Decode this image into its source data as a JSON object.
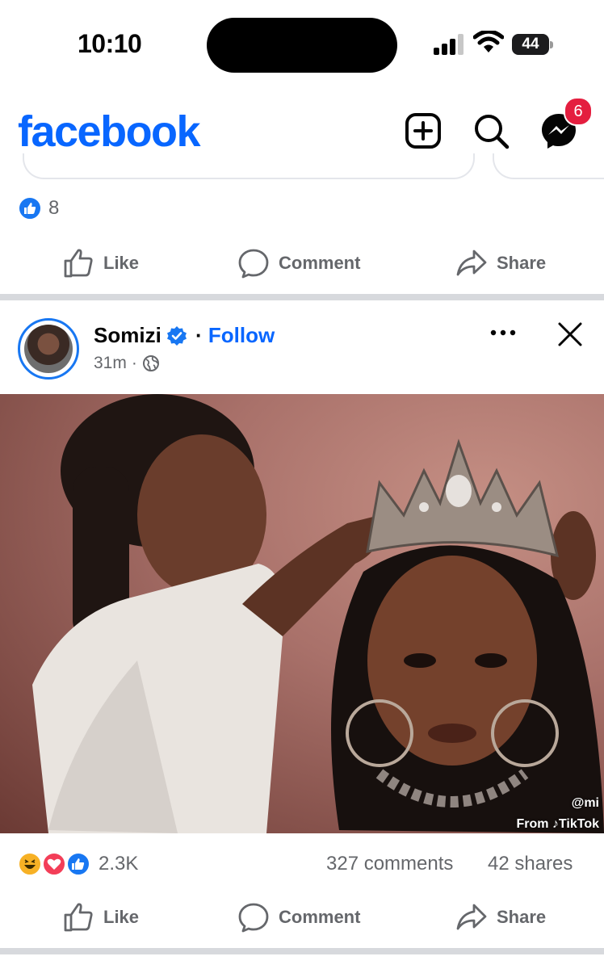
{
  "status_bar": {
    "time": "10:10",
    "battery": "44"
  },
  "header": {
    "logo": "facebook",
    "messenger_badge": "6",
    "icons": [
      "create-post-icon",
      "search-icon",
      "messenger-icon"
    ]
  },
  "prev_post": {
    "reaction_count": "8",
    "actions": {
      "like": "Like",
      "comment": "Comment",
      "share": "Share"
    }
  },
  "post": {
    "author": "Somizi",
    "follow_label": "Follow",
    "separator": "·",
    "time": "31m",
    "time_sep": "·",
    "watermark_handle": "@mi",
    "watermark_source": "From ♪TikTok",
    "reaction_count": "2.3K",
    "comments": "327 comments",
    "shares": "42 shares",
    "actions": {
      "like": "Like",
      "comment": "Comment",
      "share": "Share"
    },
    "colors": {
      "accent": "#0866ff",
      "verified": "#1877f2"
    }
  }
}
